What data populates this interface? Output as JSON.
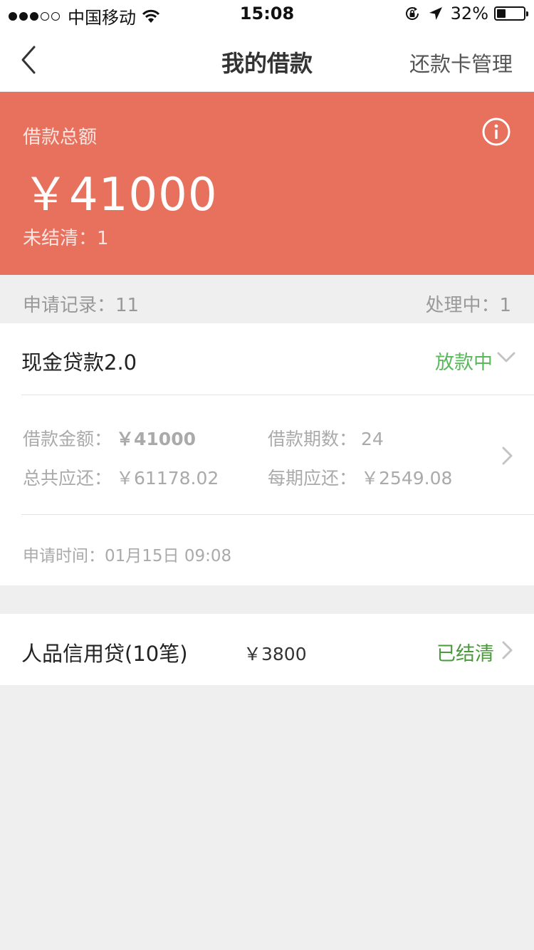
{
  "status_bar": {
    "carrier": "中国移动",
    "time": "15:08",
    "battery_percent": "32%",
    "battery_level": 0.32,
    "icons": [
      "signal-dots-icon",
      "wifi-icon",
      "orientation-lock-icon",
      "location-arrow-icon",
      "battery-icon"
    ]
  },
  "nav": {
    "title": "我的借款",
    "right_action": "还款卡管理",
    "back_icon": "chevron-left-icon"
  },
  "summary": {
    "label": "借款总额",
    "amount": "￥41000",
    "unsettled": "未结清：1",
    "info_icon": "info-icon",
    "background_color": "#e8715d"
  },
  "stats": {
    "records": "申请记录：11",
    "processing": "处理中：1"
  },
  "loan_card": {
    "name": "现金贷款2.0",
    "status": "放款中",
    "status_color": "#5cb85c",
    "details": {
      "amount_label": "借款金额：",
      "amount_value": "￥41000",
      "periods_label": "借款期数：",
      "periods_value": "24",
      "total_label": "总共应还：",
      "total_value": "￥61178.02",
      "per_period_label": "每期应还：",
      "per_period_value": "￥2549.08"
    },
    "apply_time": "申请时间：01月15日 09:08"
  },
  "loan_row": {
    "name": "人品信用贷(10笔)",
    "amount": "￥3800",
    "status": "已结清",
    "status_color": "#4a9a3c"
  }
}
